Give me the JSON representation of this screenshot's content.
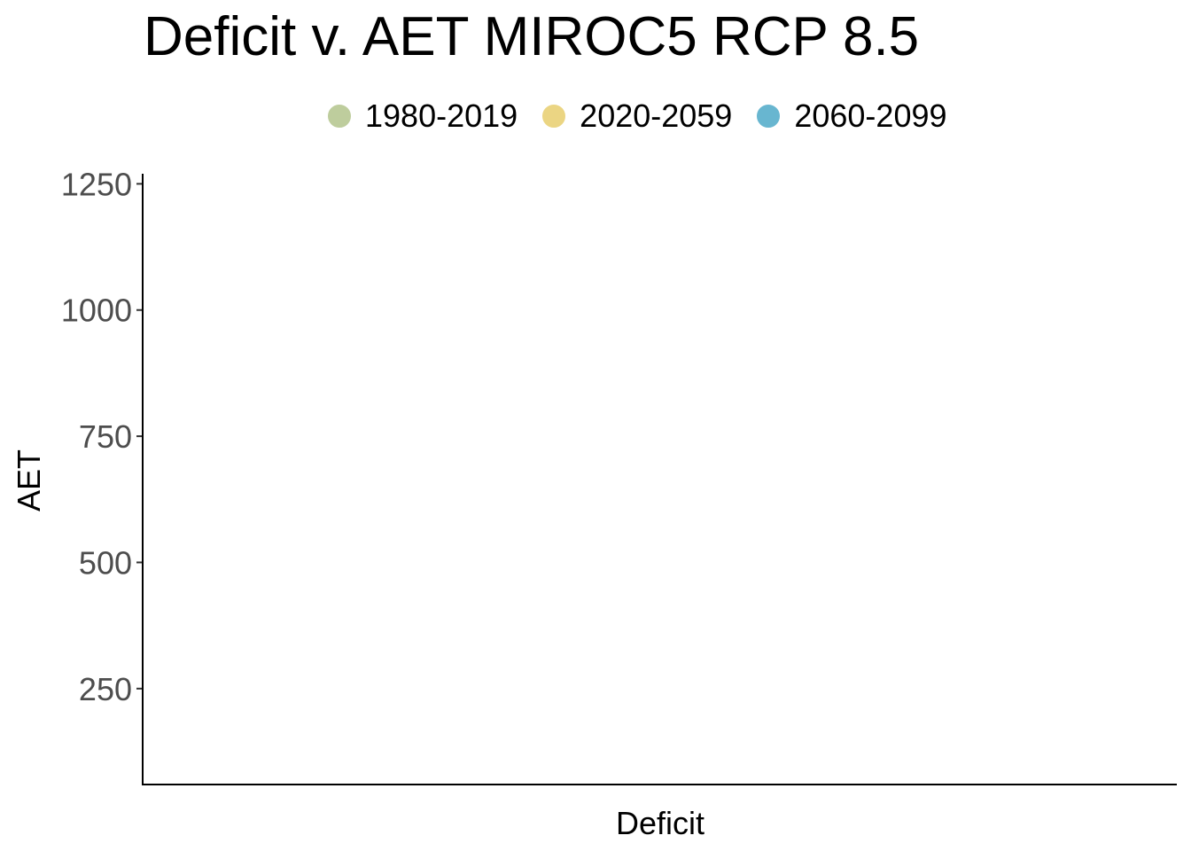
{
  "chart_data": {
    "type": "scatter",
    "title": "Deficit v. AET MIROC5 RCP 8.5",
    "xlabel": "Deficit",
    "ylabel": "AET",
    "ylim": [
      60,
      1270
    ],
    "yticks": [
      250,
      500,
      750,
      1000,
      1250
    ],
    "xticks": [],
    "grid": false,
    "legend_position": "top",
    "series": [
      {
        "name": "1980-2019",
        "color": "#c4d3a2",
        "points": []
      },
      {
        "name": "2020-2059",
        "color": "#f2dc87",
        "points": []
      },
      {
        "name": "2060-2099",
        "color": "#6bbcd6",
        "points": []
      }
    ]
  }
}
